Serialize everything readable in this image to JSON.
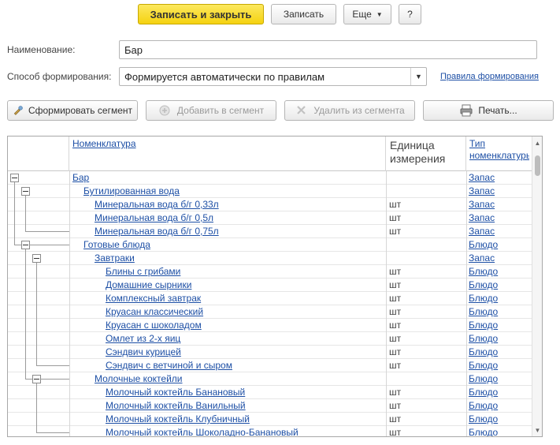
{
  "toolbar": {
    "save_close": "Записать и закрыть",
    "save": "Записать",
    "more": "Еще",
    "help": "?"
  },
  "form": {
    "name_label": "Наименование:",
    "name_value": "Бар",
    "method_label": "Способ формирования:",
    "method_value": "Формируется автоматически по правилам",
    "rules_link": "Правила формирования"
  },
  "actions": {
    "form_segment": "Сформировать сегмент",
    "add_to_segment": "Добавить в сегмент",
    "remove_from_segment": "Удалить из сегмента",
    "print": "Печать..."
  },
  "table": {
    "columns": {
      "name": "Номенклатура",
      "unit_line1": "Единица",
      "unit_line2": "измерения",
      "type_line1": "Тип",
      "type_line2": "номенклатуры"
    },
    "rows": [
      {
        "name": "Бар",
        "unit": "",
        "type": "Запас"
      },
      {
        "name": "Бутилированная вода",
        "unit": "",
        "type": "Запас"
      },
      {
        "name": "Минеральная вода б/г 0,33л",
        "unit": "шт",
        "type": "Запас"
      },
      {
        "name": "Минеральная вода б/г 0,5л",
        "unit": "шт",
        "type": "Запас"
      },
      {
        "name": "Минеральная вода б/г 0,75л",
        "unit": "шт",
        "type": "Запас"
      },
      {
        "name": "Готовые блюда",
        "unit": "",
        "type": "Блюдо"
      },
      {
        "name": "Завтраки",
        "unit": "",
        "type": "Запас"
      },
      {
        "name": "Блины с грибами",
        "unit": "шт",
        "type": "Блюдо"
      },
      {
        "name": "Домашние сырники",
        "unit": "шт",
        "type": "Блюдо"
      },
      {
        "name": "Комплексный завтрак",
        "unit": "шт",
        "type": "Блюдо"
      },
      {
        "name": "Круасан классический",
        "unit": "шт",
        "type": "Блюдо"
      },
      {
        "name": "Круасан с шоколадом",
        "unit": "шт",
        "type": "Блюдо"
      },
      {
        "name": "Омлет из 2-х яиц",
        "unit": "шт",
        "type": "Блюдо"
      },
      {
        "name": "Сэндвич курицей",
        "unit": "шт",
        "type": "Блюдо"
      },
      {
        "name": "Сэндвич с ветчиной и сыром",
        "unit": "шт",
        "type": "Блюдо"
      },
      {
        "name": "Молочные коктейли",
        "unit": "",
        "type": "Блюдо"
      },
      {
        "name": "Молочный коктейль Банановый",
        "unit": "шт",
        "type": "Блюдо"
      },
      {
        "name": "Молочный коктейль Ванильный",
        "unit": "шт",
        "type": "Блюдо"
      },
      {
        "name": "Молочный коктейль Клубничный",
        "unit": "шт",
        "type": "Блюдо"
      },
      {
        "name": "Молочный коктейль Шоколадно-Банановый",
        "unit": "шт",
        "type": "Блюдо"
      }
    ]
  }
}
